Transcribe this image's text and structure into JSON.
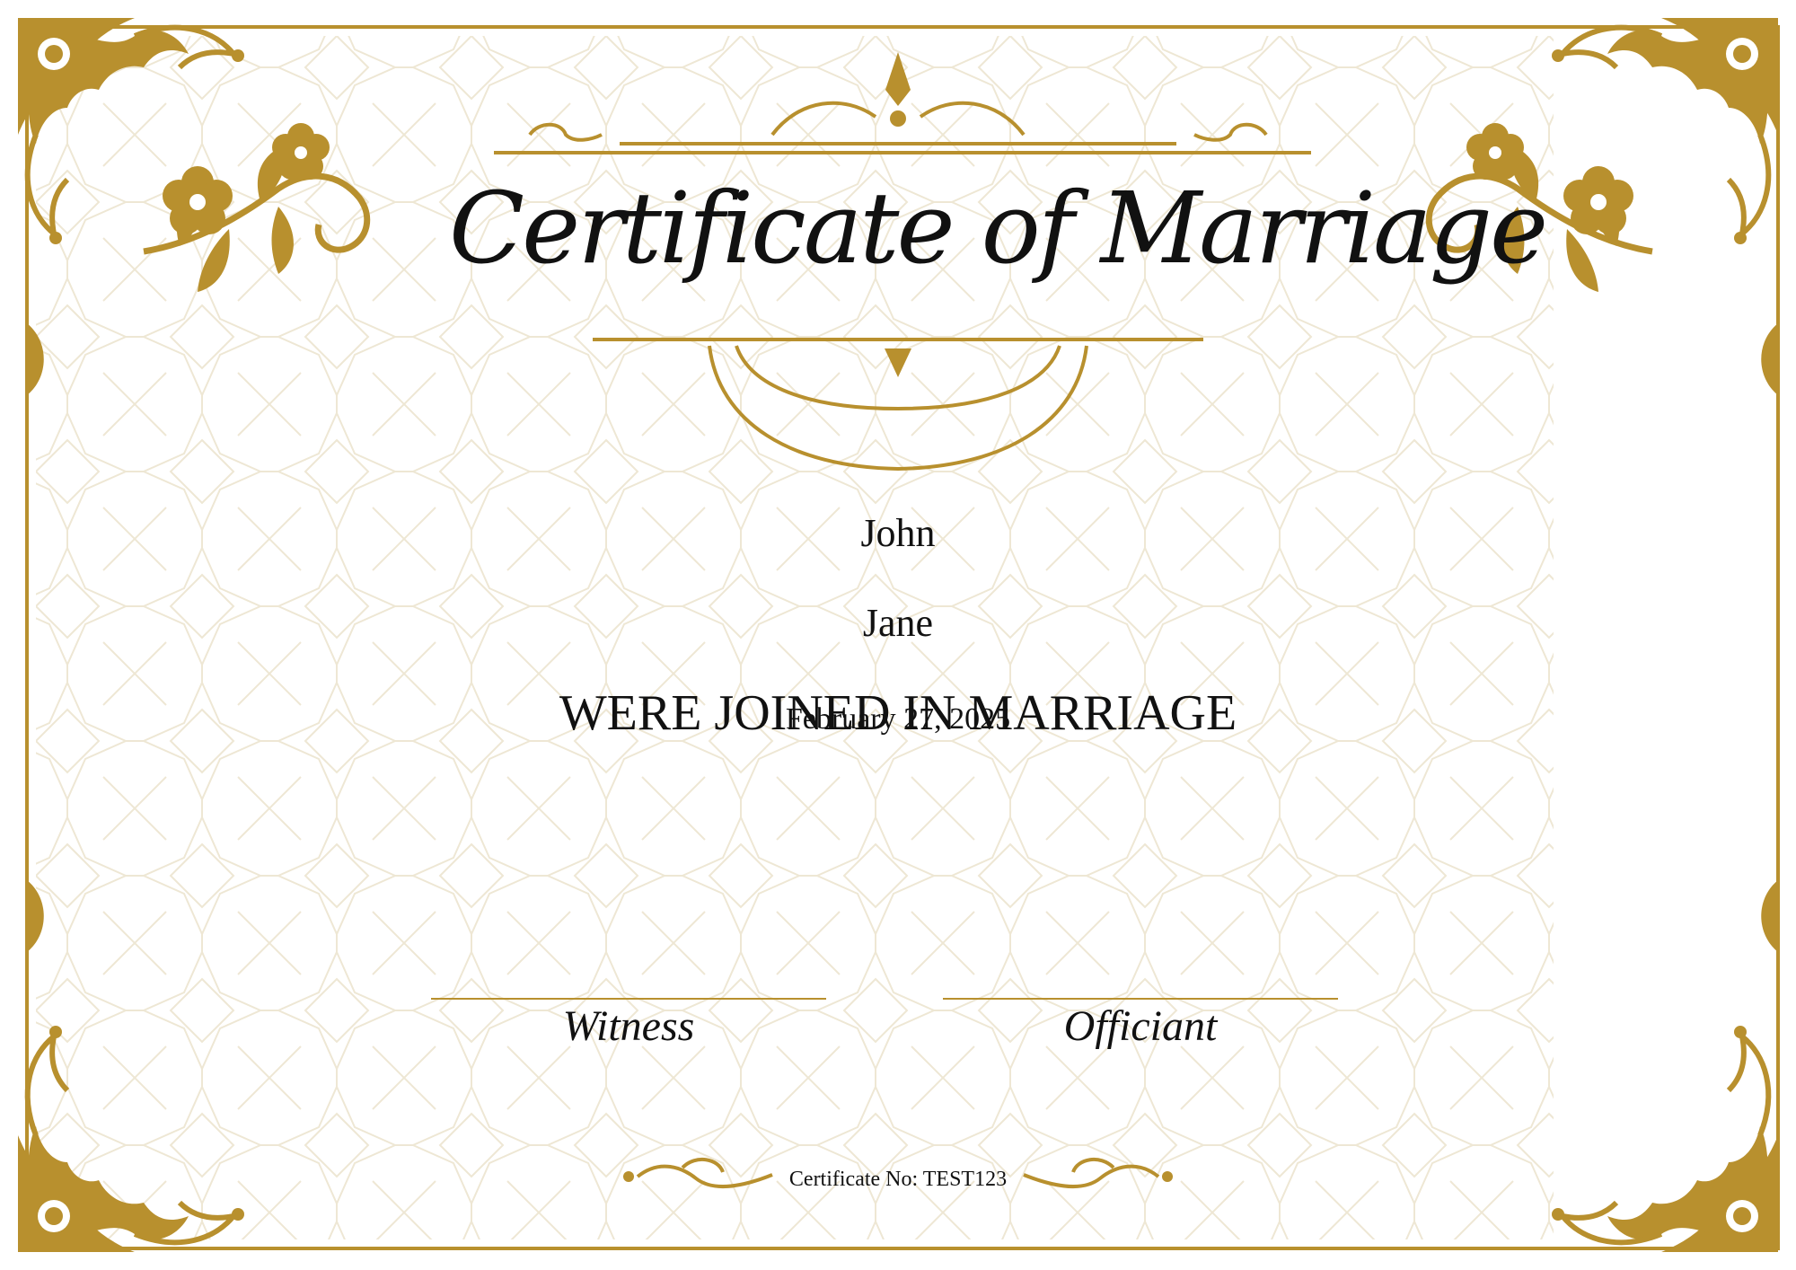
{
  "certificate": {
    "title": "Certificate of Marriage",
    "groom_name": "John",
    "bride_name": "Jane",
    "joined_text": "WERE JOINED IN MARRIAGE",
    "date": "February 27, 2025",
    "witness_label": "Witness",
    "officiant_label": "Officiant",
    "certificate_number": "Certificate No: TEST123"
  },
  "colors": {
    "gold": "#b8902e",
    "pattern": "#ece4cf",
    "background": "#ffffff",
    "text": "#111111"
  }
}
